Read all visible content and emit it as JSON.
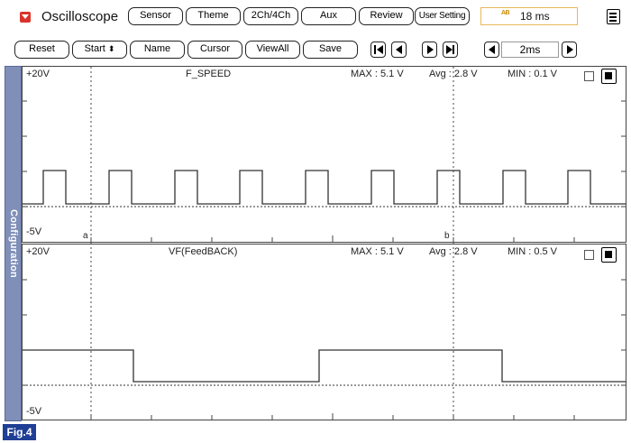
{
  "header": {
    "app_title": "Oscilloscope",
    "tabs": [
      "Sensor",
      "Theme",
      "2Ch/4Ch",
      "Aux",
      "Review",
      "User Setting"
    ],
    "time_badge": "18 ms",
    "time_icon_text": "AB"
  },
  "toolbar": {
    "reset": "Reset",
    "start": "Start",
    "name": "Name",
    "cursor": "Cursor",
    "viewall": "ViewAll",
    "save": "Save",
    "timebase": "2ms"
  },
  "sidebar": {
    "label": "Configuration"
  },
  "channels": [
    {
      "top": "+20V",
      "bottom": "-5V",
      "name": "F_SPEED",
      "max": "MAX : 5.1 V",
      "avg": "Avg : 2.8 V",
      "min": "MIN : 0.1 V",
      "cursor_a": "a",
      "cursor_b": "b"
    },
    {
      "top": "+20V",
      "bottom": "-5V",
      "name": "VF(FeedBACK)",
      "max": "MAX : 5.1 V",
      "avg": "Avg : 2.8 V",
      "min": "MIN : 0.5 V"
    }
  ],
  "figure_label": "Fig.4",
  "colors": {
    "sidebar": "#7f8fb8",
    "fig_label_bg": "#1f3f95",
    "header_icon": "#d9342b",
    "badge_border": "#e8b85a"
  }
}
